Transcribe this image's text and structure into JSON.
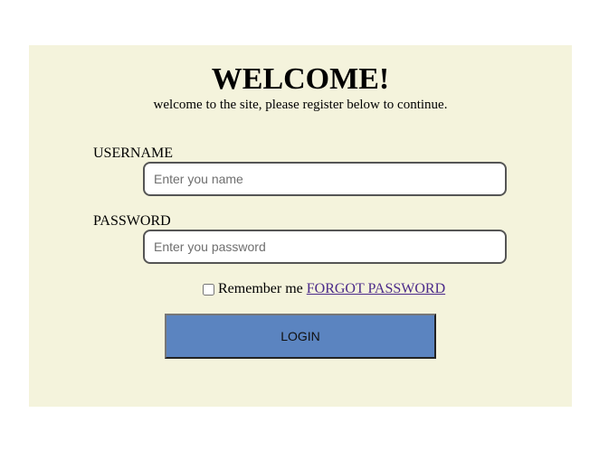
{
  "header": {
    "title": "WELCOME!",
    "subtitle": "welcome to the site, please register below to continue."
  },
  "form": {
    "username_label": "USERNAME",
    "username_placeholder": "Enter you name",
    "username_value": "",
    "password_label": "PASSWORD",
    "password_placeholder": "Enter you password",
    "password_value": "",
    "remember_label": "Remember me",
    "remember_checked": false,
    "forgot_link": "FORGOT PASSWORD",
    "login_button": "LOGIN"
  },
  "colors": {
    "panel_background": "#f4f3dc",
    "button_background": "#5b84c0",
    "link_color": "#4b2a8a"
  }
}
